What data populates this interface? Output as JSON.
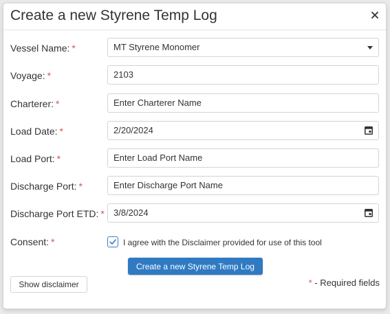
{
  "modal": {
    "title": "Create a new Styrene Temp Log",
    "close_icon": "close-icon"
  },
  "form": {
    "vessel_name": {
      "label": "Vessel Name:",
      "value": "MT Styrene Monomer"
    },
    "voyage": {
      "label": "Voyage:",
      "value": "2103"
    },
    "charterer": {
      "label": "Charterer:",
      "placeholder": "Enter Charterer Name"
    },
    "load_date": {
      "label": "Load Date:",
      "value": "2/20/2024"
    },
    "load_port": {
      "label": "Load Port:",
      "placeholder": "Enter Load Port Name"
    },
    "discharge_port": {
      "label": "Discharge Port:",
      "placeholder": "Enter Discharge Port Name"
    },
    "discharge_port_etd": {
      "label": "Discharge Port ETD:",
      "value": "3/8/2024"
    },
    "consent": {
      "label": "Consent:",
      "checked": true,
      "text": "I agree with the Disclaimer provided for use of this tool"
    },
    "required_star": "*"
  },
  "actions": {
    "create_label": "Create a new Styrene Temp Log",
    "disclaimer_label": "Show disclaimer"
  },
  "footer": {
    "required_star": "*",
    "required_text": " - Required fields"
  },
  "colors": {
    "primary": "#2f7ac2",
    "required": "#d9534f",
    "checkbox": "#3a7bc0"
  }
}
